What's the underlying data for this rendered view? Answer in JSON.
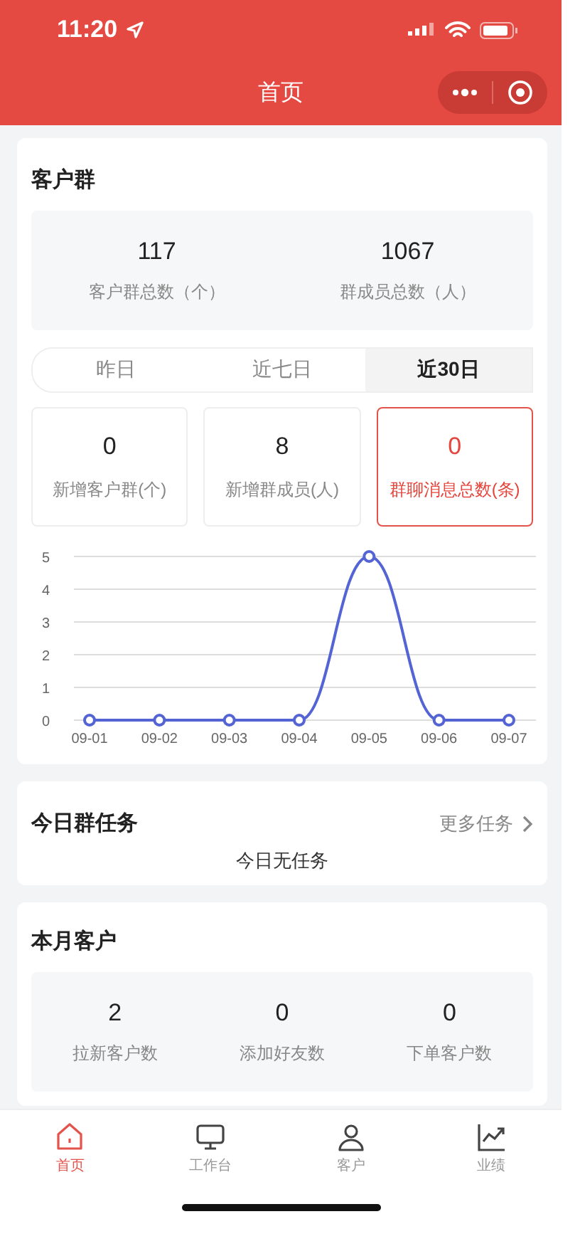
{
  "status_bar": {
    "time": "11:20"
  },
  "nav": {
    "title": "首页"
  },
  "customer_groups": {
    "title": "客户群",
    "summary": [
      {
        "value": "117",
        "label": "客户群总数（个）"
      },
      {
        "value": "1067",
        "label": "群成员总数（人）"
      }
    ],
    "tabs": [
      {
        "label": "昨日",
        "selected": false
      },
      {
        "label": "近七日",
        "selected": false
      },
      {
        "label": "近30日",
        "selected": true
      }
    ],
    "stats": [
      {
        "value": "0",
        "label": "新增客户群(个)",
        "highlighted": false
      },
      {
        "value": "8",
        "label": "新增群成员(人)",
        "highlighted": false
      },
      {
        "value": "0",
        "label": "群聊消息总数(条)",
        "highlighted": true
      }
    ],
    "chart_data": {
      "type": "line",
      "categories": [
        "09-01",
        "09-02",
        "09-03",
        "09-04",
        "09-05",
        "09-06",
        "09-07"
      ],
      "series": [
        {
          "color": "#5464d4",
          "marker": true,
          "values": [
            0,
            0,
            0,
            0,
            5,
            0,
            0
          ]
        }
      ],
      "grid": true,
      "ylim": [
        0,
        5
      ],
      "yticks": [
        0,
        1,
        2,
        3,
        4,
        5
      ]
    }
  },
  "group_tasks": {
    "title": "今日群任务",
    "more_link": "更多任务",
    "empty_text": "今日无任务"
  },
  "monthly_customers": {
    "title": "本月客户",
    "stats": [
      {
        "value": "2",
        "label": "拉新客户数"
      },
      {
        "value": "0",
        "label": "添加好友数"
      },
      {
        "value": "0",
        "label": "下单客户数"
      }
    ]
  },
  "tab_bar": [
    {
      "kind": "home",
      "label": "首页",
      "selected": true
    },
    {
      "kind": "desk",
      "label": "工作台",
      "selected": false
    },
    {
      "kind": "person",
      "label": "客户",
      "selected": false
    },
    {
      "kind": "chart",
      "label": "业绩",
      "selected": false
    }
  ]
}
